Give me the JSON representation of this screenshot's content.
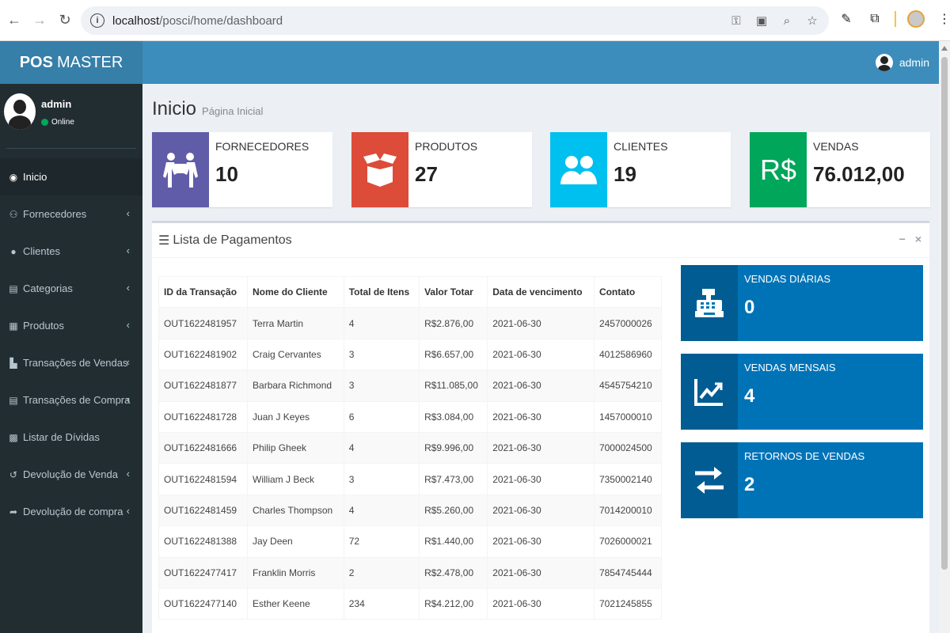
{
  "browser": {
    "url_host": "localhost",
    "url_path": "/posci/home/dashboard"
  },
  "app": {
    "logo_bold": "POS",
    "logo_rest": "MASTER",
    "header_user": "admin"
  },
  "sidebar": {
    "user_name": "admin",
    "user_status": "Online",
    "items": [
      {
        "label": "Inicio",
        "icon": "dashboard-icon",
        "glyph": "◉",
        "active": true,
        "has_chevron": false
      },
      {
        "label": "Fornecedores",
        "icon": "suppliers-icon",
        "glyph": "⚇",
        "has_chevron": true
      },
      {
        "label": "Clientes",
        "icon": "users-icon",
        "glyph": "●",
        "has_chevron": true
      },
      {
        "label": "Categorias",
        "icon": "list-icon",
        "glyph": "▤",
        "has_chevron": true
      },
      {
        "label": "Produtos",
        "icon": "cubes-icon",
        "glyph": "▦",
        "has_chevron": true
      },
      {
        "label": "Transações de Vendas",
        "icon": "cart-icon",
        "glyph": "▙",
        "has_chevron": true
      },
      {
        "label": "Transações de Compra",
        "icon": "receipt-icon",
        "glyph": "▤",
        "has_chevron": true
      },
      {
        "label": "Listar de Dívidas",
        "icon": "money-icon",
        "glyph": "▩",
        "has_chevron": false
      },
      {
        "label": "Devolução de Venda",
        "icon": "undo-icon",
        "glyph": "↺",
        "has_chevron": true
      },
      {
        "label": "Devolução de compra",
        "icon": "share-icon",
        "glyph": "➦",
        "has_chevron": true
      }
    ]
  },
  "page": {
    "title": "Inicio",
    "subtitle": "Página Inicial"
  },
  "info_boxes": [
    {
      "label": "FORNECEDORES",
      "value": "10",
      "color": "#605ca8",
      "icon": "people-carry-icon"
    },
    {
      "label": "PRODUTOS",
      "value": "27",
      "color": "#dd4b39",
      "icon": "box-open-icon"
    },
    {
      "label": "CLIENTES",
      "value": "19",
      "color": "#00c0ef",
      "icon": "users-icon"
    },
    {
      "label": "VENDAS",
      "value": "76.012,00",
      "color": "#00a65a",
      "icon": "currency-icon",
      "icon_text": "R$"
    }
  ],
  "payments": {
    "title": "Lista de Pagamentos",
    "minimize": "−",
    "close": "×",
    "columns": [
      "ID da Transação",
      "Nome do Cliente",
      "Total de Itens",
      "Valor Totar",
      "Data de vencimento",
      "Contato"
    ],
    "rows": [
      [
        "OUT1622481957",
        "Terra Martin",
        "4",
        "R$2.876,00",
        "2021-06-30",
        "2457000026"
      ],
      [
        "OUT1622481902",
        "Craig Cervantes",
        "3",
        "R$6.657,00",
        "2021-06-30",
        "4012586960"
      ],
      [
        "OUT1622481877",
        "Barbara Richmond",
        "3",
        "R$11.085,00",
        "2021-06-30",
        "4545754210"
      ],
      [
        "OUT1622481728",
        "Juan J Keyes",
        "6",
        "R$3.084,00",
        "2021-06-30",
        "1457000010"
      ],
      [
        "OUT1622481666",
        "Philip Gheek",
        "4",
        "R$9.996,00",
        "2021-06-30",
        "7000024500"
      ],
      [
        "OUT1622481594",
        "William J Beck",
        "3",
        "R$7.473,00",
        "2021-06-30",
        "7350002140"
      ],
      [
        "OUT1622481459",
        "Charles Thompson",
        "4",
        "R$5.260,00",
        "2021-06-30",
        "7014200010"
      ],
      [
        "OUT1622481388",
        "Jay Deen",
        "72",
        "R$1.440,00",
        "2021-06-30",
        "7026000021"
      ],
      [
        "OUT1622477417",
        "Franklin Morris",
        "2",
        "R$2.478,00",
        "2021-06-30",
        "7854745444"
      ],
      [
        "OUT1622477140",
        "Esther Keene",
        "234",
        "R$4.212,00",
        "2021-06-30",
        "7021245855"
      ]
    ]
  },
  "stat_boxes": [
    {
      "label": "VENDAS DIÁRIAS",
      "value": "0",
      "icon": "cash-register-icon"
    },
    {
      "label": "VENDAS MENSAIS",
      "value": "4",
      "icon": "chart-area-icon"
    },
    {
      "label": "RETORNOS DE VENDAS",
      "value": "2",
      "icon": "exchange-icon"
    }
  ],
  "colors": {
    "header": "#3c8dbc",
    "logo": "#367fa9",
    "sidebar": "#222d32",
    "stat_box": "#0073b7"
  }
}
